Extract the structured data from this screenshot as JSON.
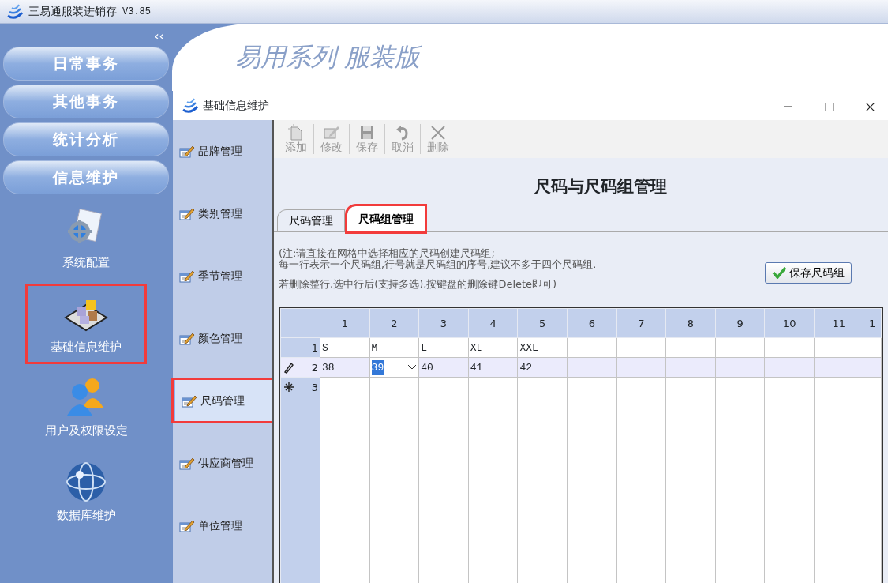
{
  "app": {
    "title": "三易通服装进销存",
    "version": "V3.85",
    "collapse": "‹‹",
    "slogan": "易用系列 服装版"
  },
  "main_menu": [
    {
      "label": "日常事务"
    },
    {
      "label": "其他事务"
    },
    {
      "label": "统计分析"
    },
    {
      "label": "信息维护"
    }
  ],
  "modules": [
    {
      "label": "系统配置",
      "kind": "config",
      "highlighted": false
    },
    {
      "label": "基础信息维护",
      "kind": "cubes",
      "highlighted": true
    },
    {
      "label": "用户及权限设定",
      "kind": "users",
      "highlighted": false
    },
    {
      "label": "数据库维护",
      "kind": "globe",
      "highlighted": false
    }
  ],
  "window": {
    "title": "基础信息维护"
  },
  "nav": [
    {
      "label": "品牌管理",
      "selected": false,
      "highlighted": false
    },
    {
      "label": "类别管理",
      "selected": false,
      "highlighted": false
    },
    {
      "label": "季节管理",
      "selected": false,
      "highlighted": false
    },
    {
      "label": "颜色管理",
      "selected": false,
      "highlighted": false
    },
    {
      "label": "尺码管理",
      "selected": true,
      "highlighted": true
    },
    {
      "label": "供应商管理",
      "selected": false,
      "highlighted": false
    },
    {
      "label": "单位管理",
      "selected": false,
      "highlighted": false
    }
  ],
  "toolbar": [
    {
      "label": "添加",
      "kind": "add",
      "disabled": true
    },
    {
      "label": "修改",
      "kind": "edit",
      "disabled": true
    },
    {
      "label": "保存",
      "kind": "save",
      "disabled": true
    },
    {
      "label": "取消",
      "kind": "undo",
      "disabled": true
    },
    {
      "label": "删除",
      "kind": "delete",
      "disabled": true
    }
  ],
  "heading": "尺码与尺码组管理",
  "tabs": [
    {
      "label": "尺码管理",
      "selected": false,
      "highlighted": false
    },
    {
      "label": "尺码组管理",
      "selected": true,
      "highlighted": true
    }
  ],
  "notes": [
    "(注:请直接在网格中选择相应的尺码创建尺码组;",
    "每一行表示一个尺码组,行号就是尺码组的序号,建议不多于四个尺码组.",
    "若删除整行,选中行后(支持多选),按键盘的删除键Delete即可)"
  ],
  "save_button": "保存尺码组",
  "grid": {
    "columns": [
      "1",
      "2",
      "3",
      "4",
      "5",
      "6",
      "7",
      "8",
      "9",
      "10",
      "11",
      "1"
    ],
    "rows": [
      {
        "number": "1",
        "kind": "plain",
        "current": false,
        "cells": [
          {
            "text": "S"
          },
          {
            "text": "M"
          },
          {
            "text": "L"
          },
          {
            "text": "XL"
          },
          {
            "text": "XXL"
          }
        ]
      },
      {
        "number": "2",
        "kind": "edit",
        "current": true,
        "cells": [
          {
            "text": "38"
          },
          {
            "text": "39",
            "editing": true
          },
          {
            "text": "40"
          },
          {
            "text": "41"
          },
          {
            "text": "42"
          }
        ]
      },
      {
        "number": "3",
        "kind": "new",
        "current": false,
        "cells": []
      }
    ]
  }
}
